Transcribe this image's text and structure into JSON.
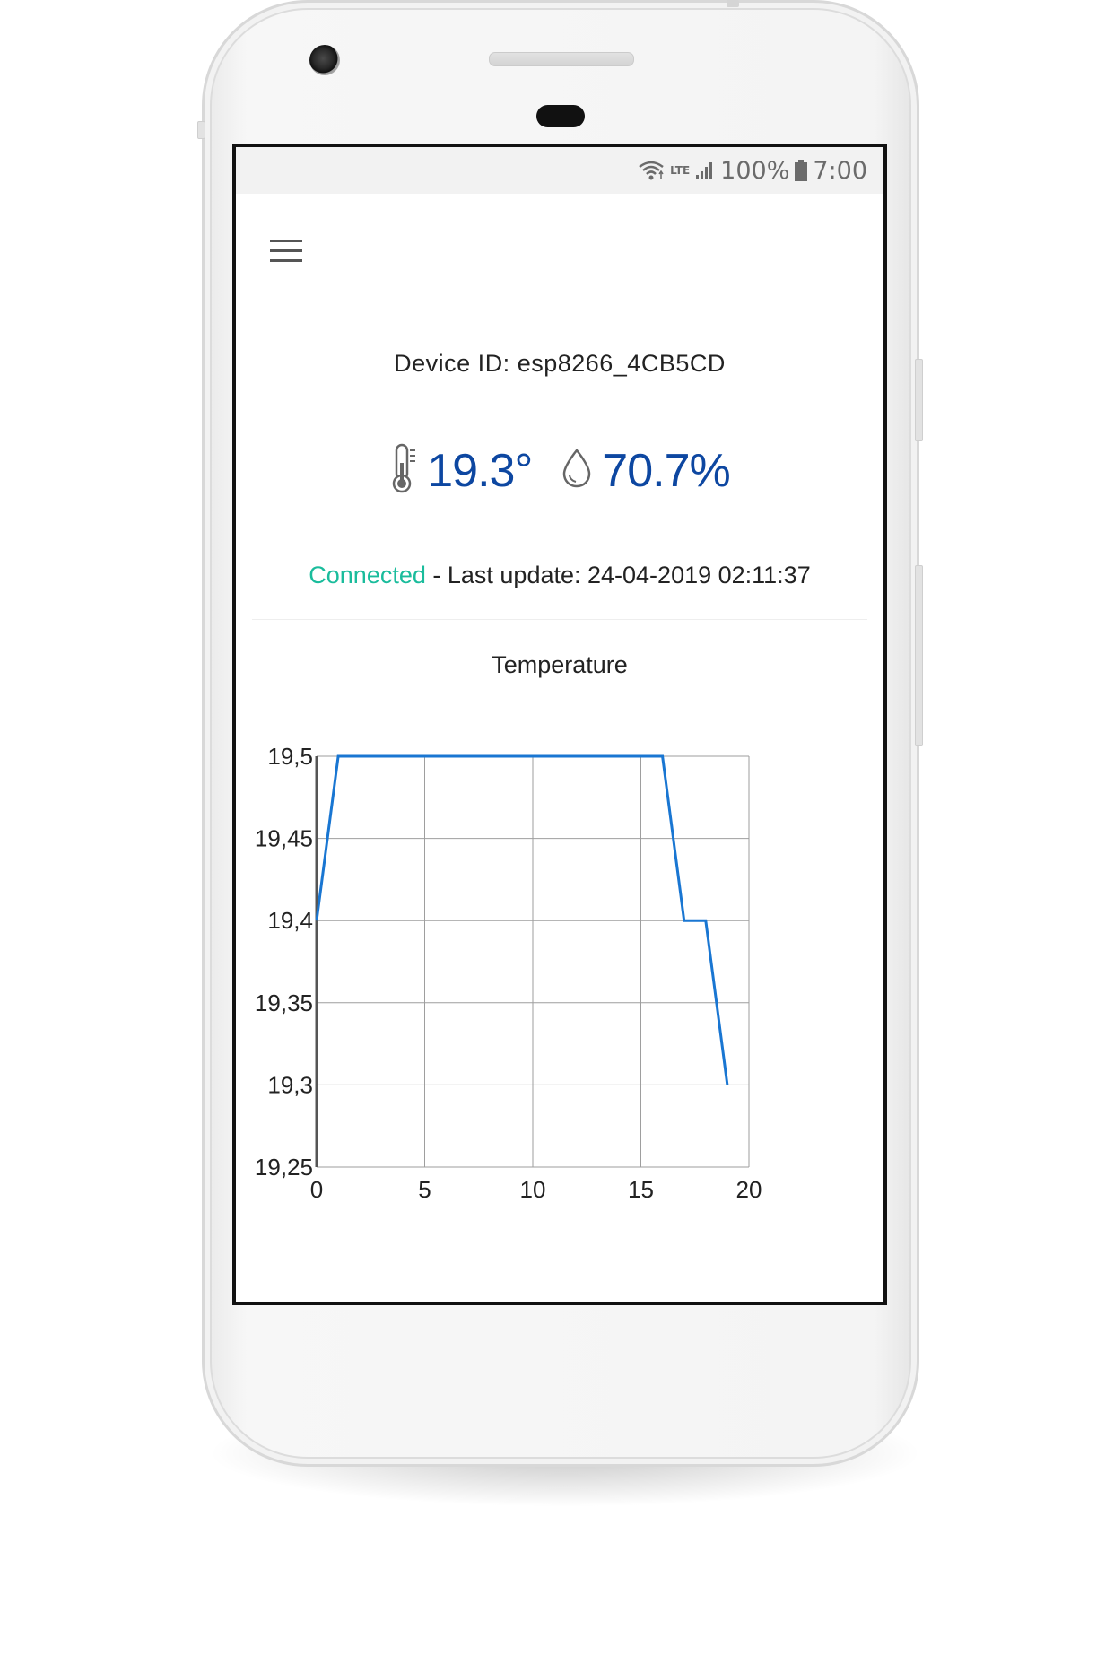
{
  "status_bar": {
    "wifi_icon": "wifi-icon",
    "lte_label": "LTE",
    "signal_icon": "signal-icon",
    "battery_percent": "100%",
    "battery_icon": "battery-icon",
    "time": "7:00"
  },
  "header": {
    "menu_icon": "hamburger-menu-icon"
  },
  "device": {
    "id_text": "Device ID: esp8266_4CB5CD"
  },
  "readings": {
    "temperature": "19.3°",
    "humidity": "70.7%",
    "temperature_icon": "thermometer-icon",
    "humidity_icon": "droplet-icon",
    "value_color": "#0d47a1"
  },
  "connection": {
    "status": "Connected",
    "status_color": "#1abc9c",
    "last_update": " - Last update: 24-04-2019 02:11:37"
  },
  "chart_data": {
    "type": "line",
    "title": "Temperature",
    "xlabel": "",
    "ylabel": "",
    "x": [
      0,
      1,
      2,
      3,
      4,
      5,
      6,
      7,
      8,
      9,
      10,
      11,
      12,
      13,
      14,
      15,
      16,
      17,
      18,
      19
    ],
    "y": [
      19.4,
      19.5,
      19.5,
      19.5,
      19.5,
      19.5,
      19.5,
      19.5,
      19.5,
      19.5,
      19.5,
      19.5,
      19.5,
      19.5,
      19.5,
      19.5,
      19.5,
      19.4,
      19.4,
      19.3
    ],
    "xlim": [
      0,
      20
    ],
    "ylim": [
      19.25,
      19.5
    ],
    "xticks": [
      "0",
      "5",
      "10",
      "15",
      "20"
    ],
    "yticks": [
      "19,5",
      "19,45",
      "19,4",
      "19,35",
      "19,3",
      "19,25"
    ],
    "line_color": "#1976d2",
    "grid": true
  }
}
